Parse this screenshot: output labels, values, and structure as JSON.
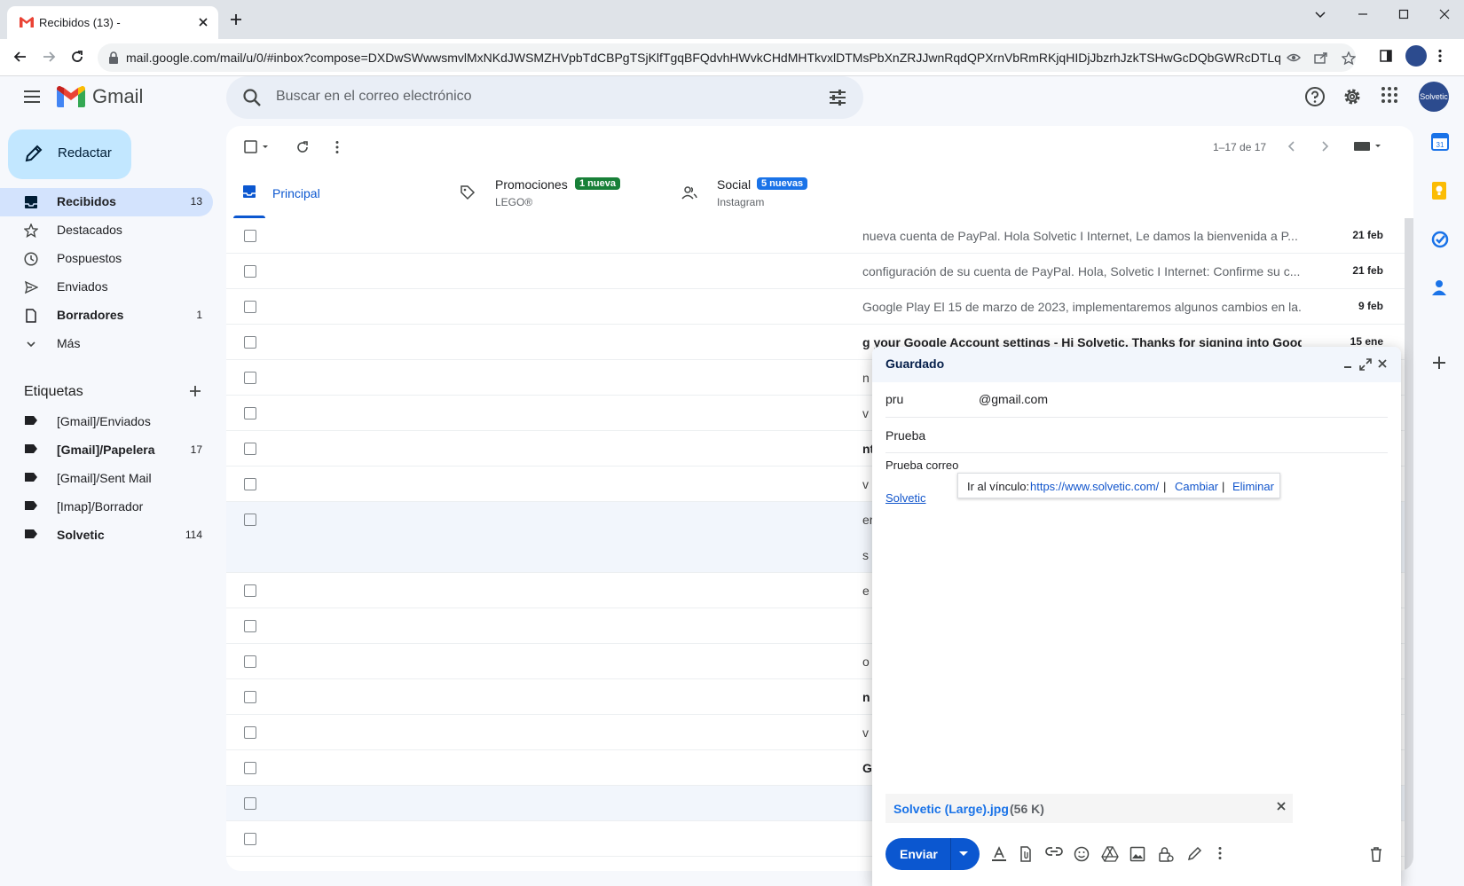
{
  "browser": {
    "tab_title": "Recibidos (13) -",
    "url": "mail.google.com/mail/u/0/#inbox?compose=DXDwSWwwsmvlMxNKdJWSMZHVpbTdCBPgTSjKlfTgqBFQdvhHWvkCHdMHTkvxlDTMsPbXnZRJJwnRqdQPXrnVbRmRKjqHIDjJbzrhJzkTSHwGcDQbGWRcDTLq"
  },
  "gmail": {
    "logo_text": "Gmail",
    "search_placeholder": "Buscar en el correo electrónico",
    "avatar_text": "Solvetic",
    "compose_label": "Redactar"
  },
  "nav": {
    "items": [
      {
        "label": "Recibidos",
        "count": "13",
        "icon": "inbox-icon",
        "active": true,
        "bold": true
      },
      {
        "label": "Destacados",
        "count": "",
        "icon": "star-icon",
        "active": false,
        "bold": false
      },
      {
        "label": "Pospuestos",
        "count": "",
        "icon": "clock-icon",
        "active": false,
        "bold": false
      },
      {
        "label": "Enviados",
        "count": "",
        "icon": "send-icon",
        "active": false,
        "bold": false
      },
      {
        "label": "Borradores",
        "count": "1",
        "icon": "draft-icon",
        "active": false,
        "bold": true
      },
      {
        "label": "Más",
        "count": "",
        "icon": "chevron-down-icon",
        "active": false,
        "bold": false
      }
    ],
    "labels_header": "Etiquetas",
    "labels": [
      {
        "label": "[Gmail]/Enviados",
        "count": "",
        "bold": false
      },
      {
        "label": "[Gmail]/Papelera",
        "count": "17",
        "bold": true
      },
      {
        "label": "[Gmail]/Sent Mail",
        "count": "",
        "bold": false
      },
      {
        "label": "[Imap]/Borrador",
        "count": "",
        "bold": false
      },
      {
        "label": "Solvetic",
        "count": "114",
        "bold": true
      }
    ]
  },
  "list": {
    "pager": "1–17 de 17",
    "categories": [
      {
        "name": "Principal",
        "sub": "",
        "badge": ""
      },
      {
        "name": "Promociones",
        "sub": "LEGO®",
        "badge": "1 nueva"
      },
      {
        "name": "Social",
        "sub": "Instagram",
        "badge": "5 nuevas"
      }
    ],
    "rows": [
      {
        "snippet": "nueva cuenta de PayPal. Hola Solvetic I Internet, Le damos la bienvenida a P...",
        "date": "21 feb"
      },
      {
        "snippet": "configuración de su cuenta de PayPal. Hola, Solvetic I Internet: Confirme su c...",
        "date": "21 feb"
      },
      {
        "snippet": "Google Play El 15 de marzo de 2023, implementaremos algunos cambios en la...",
        "date": "9 feb"
      },
      {
        "snippet": "g your Google Account settings - Hi Solvetic, Thanks for signing into Googl...",
        "date": "15 ene"
      }
    ],
    "fragments": [
      "n",
      "v",
      "nt",
      "v",
      "er",
      "s",
      "e",
      "o",
      "n",
      "v",
      "G"
    ]
  },
  "compose": {
    "title": "Guardado",
    "to_left": "pru",
    "to_right": "@gmail.com",
    "subject": "Prueba",
    "body": "Prueba correo",
    "link_text": "Solvetic",
    "tooltip_prefix": "Ir al vínculo:",
    "tooltip_url": "https://www.solvetic.com/",
    "tooltip_sep": "|",
    "tooltip_change": "Cambiar",
    "tooltip_remove": "Eliminar",
    "attachment_name": "Solvetic (Large).jpg",
    "attachment_size": "(56 K)",
    "send_label": "Enviar"
  },
  "colors": {
    "accent": "#0b57d0",
    "promo_badge": "#188038",
    "social_badge": "#1a73e8"
  }
}
